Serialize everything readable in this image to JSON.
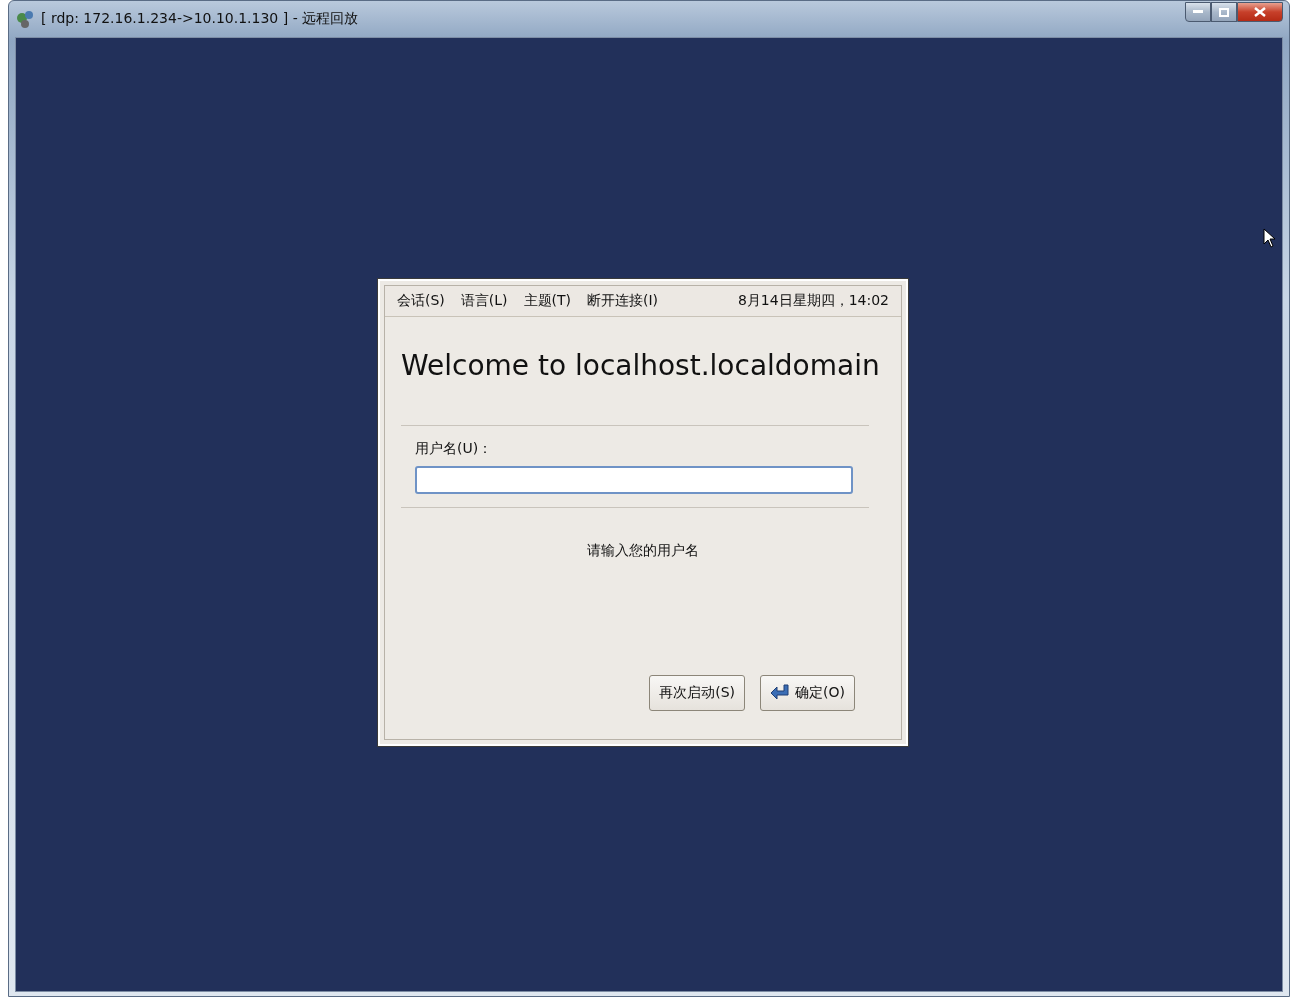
{
  "window": {
    "title": "[ rdp: 172.16.1.234->10.10.1.130 ] - 远程回放"
  },
  "menu": [
    "会话(S)",
    "语言(L)",
    "主题(T)",
    "断开连接(I)"
  ],
  "clock": "8月14日星期四，14:02",
  "welcome": "Welcome to localhost.localdomain",
  "username": {
    "label": "用户名(U)："
  },
  "message": "请输入您的用户名",
  "buttons": [
    {
      "label": "再次启动(S)",
      "kind": "plain"
    },
    {
      "label": "确定(O)",
      "kind": "ok"
    }
  ]
}
